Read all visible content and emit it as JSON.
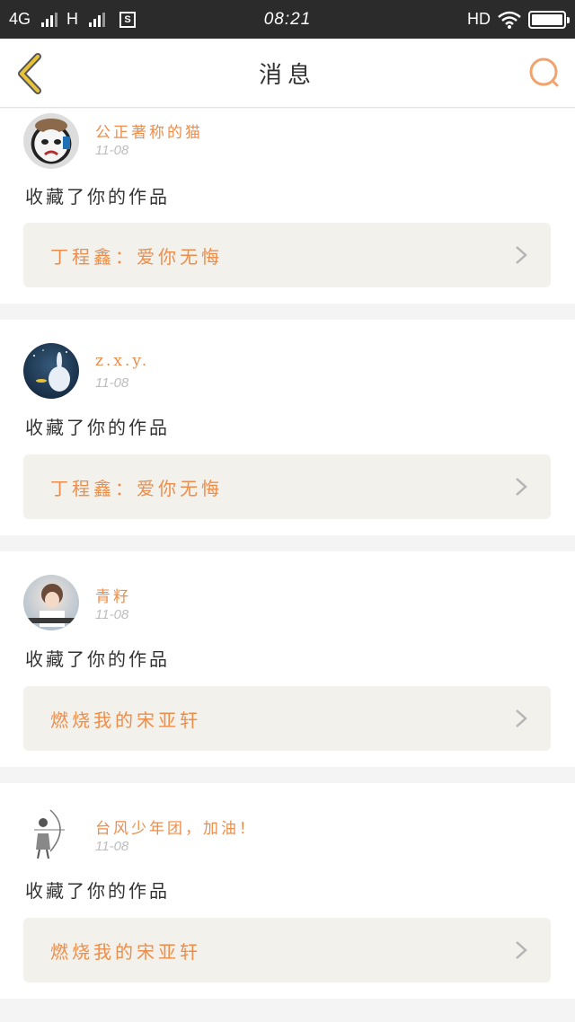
{
  "status_bar": {
    "network1": "4G",
    "network2": "H",
    "time": "08:21",
    "hd": "HD"
  },
  "nav": {
    "title": "消息"
  },
  "messages": [
    {
      "username": "公正著称的猫",
      "date": "11-08",
      "action": "收藏了你的作品",
      "work_title": "丁程鑫：爱你无悔"
    },
    {
      "username": "z.x.y.",
      "date": "11-08",
      "action": "收藏了你的作品",
      "work_title": "丁程鑫：爱你无悔"
    },
    {
      "username": "青籽",
      "date": "11-08",
      "action": "收藏了你的作品",
      "work_title": "燃烧我的宋亚轩"
    },
    {
      "username": "台风少年团，加油！",
      "date": "11-08",
      "action": "收藏了你的作品",
      "work_title": "燃烧我的宋亚轩"
    }
  ],
  "colors": {
    "accent": "#ee8d4a",
    "back_icon": "#e8c33a",
    "statusbar_bg": "#2b2b2b"
  }
}
